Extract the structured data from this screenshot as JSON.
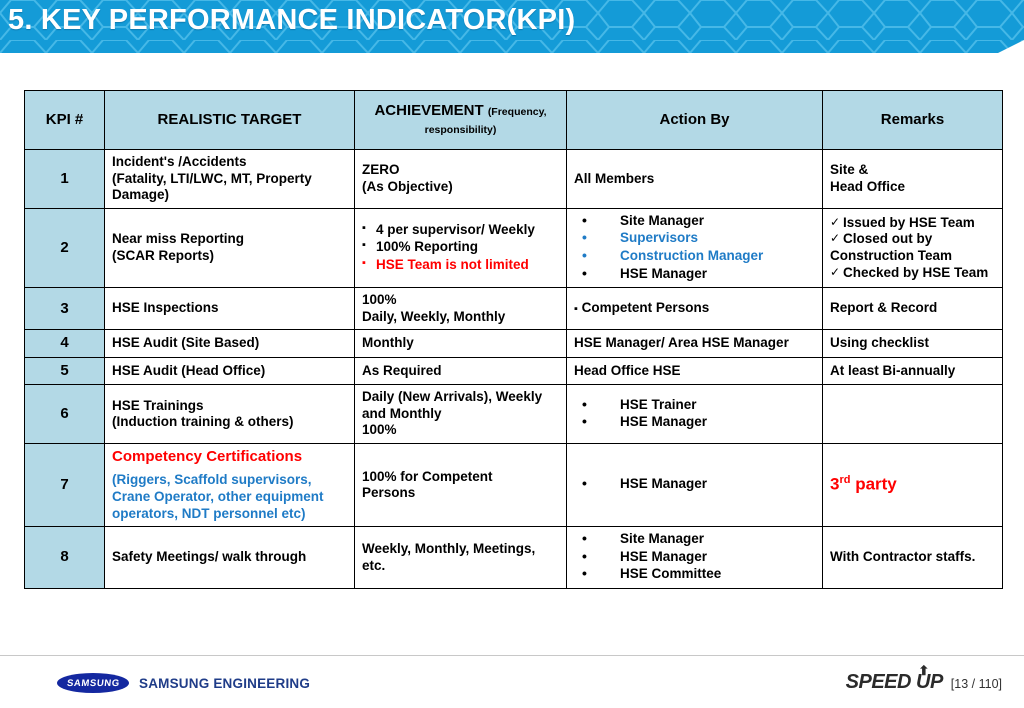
{
  "slide": {
    "title": "5. KEY PERFORMANCE INDICATOR(KPI)",
    "accent_color": "#149BD7",
    "header_cell_color": "#B3D9E6",
    "red": "#FF0000",
    "blue": "#1F7BC6"
  },
  "table": {
    "headers": {
      "kpi_num": "KPI #",
      "realistic_target": "REALISTIC TARGET",
      "achievement_main": "ACHIEVEMENT",
      "achievement_sub": "(Frequency, responsibility)",
      "action_by": "Action By",
      "remarks": "Remarks"
    },
    "rows": [
      {
        "num": "1",
        "target": [
          "Incident's /Accidents",
          "(Fatality, LTI/LWC, MT, Property",
          "Damage)"
        ],
        "achievement": [
          "ZERO",
          "(As Objective)"
        ],
        "action_by": [
          "All Members"
        ],
        "remarks": [
          "Site &",
          " Head Office"
        ]
      },
      {
        "num": "2",
        "target": [
          "Near miss Reporting",
          "(SCAR Reports)"
        ],
        "achievement_items": [
          {
            "marker": "square",
            "text": "4 per supervisor/  Weekly",
            "color": "black"
          },
          {
            "marker": "square",
            "text": "100% Reporting",
            "color": "black"
          },
          {
            "marker": "square",
            "text": "HSE Team is not limited",
            "color": "red"
          }
        ],
        "action_items": [
          {
            "text": "Site Manager",
            "color": "black",
            "bullet": "black"
          },
          {
            "text": "Supervisors",
            "color": "blue",
            "bullet": "blue"
          },
          {
            "text": "Construction Manager",
            "color": "blue",
            "bullet": "blue"
          },
          {
            "text": "HSE Manager",
            "color": "black",
            "bullet": "black"
          }
        ],
        "remark_checks": [
          "Issued by HSE Team",
          "Closed out by",
          "Construction Team",
          "Checked by HSE Team"
        ],
        "remark_check_flags": [
          true,
          true,
          false,
          true
        ]
      },
      {
        "num": "3",
        "target": [
          "HSE Inspections"
        ],
        "achievement": [
          "100%",
          "Daily, Weekly, Monthly"
        ],
        "action_by_square": "Competent Persons",
        "remarks": [
          "Report & Record"
        ]
      },
      {
        "num": "4",
        "target": [
          "HSE Audit (Site Based)"
        ],
        "achievement": [
          "Monthly"
        ],
        "action_by": [
          "HSE Manager/ Area HSE Manager"
        ],
        "remarks": [
          "Using checklist"
        ]
      },
      {
        "num": "5",
        "target": [
          "HSE Audit (Head Office)"
        ],
        "achievement": [
          "As Required"
        ],
        "action_by": [
          "Head Office HSE"
        ],
        "remarks": [
          "At least Bi-annually"
        ]
      },
      {
        "num": "6",
        "target": [
          "HSE Trainings",
          "(Induction training & others)"
        ],
        "achievement_red": [
          "Daily (New Arrivals), Weekly",
          "and Monthly",
          "100%"
        ],
        "action_items": [
          {
            "text": "HSE Trainer",
            "color": "black",
            "bullet": "black"
          },
          {
            "text": "HSE Manager",
            "color": "black",
            "bullet": "black"
          }
        ],
        "remarks": [
          ""
        ]
      },
      {
        "num": "7",
        "target_red": "Competency Certifications",
        "target_blue": [
          "(Riggers, Scaffold supervisors,",
          "Crane Operator, other equipment",
          "operators, NDT personnel etc)"
        ],
        "achievement": [
          "100% for Competent",
          "Persons"
        ],
        "action_items": [
          {
            "text": "HSE Manager",
            "color": "black",
            "bullet": "black"
          }
        ],
        "remarks_big_red_pre": "3",
        "remarks_big_red_sup": "rd",
        "remarks_big_red_post": " party"
      },
      {
        "num": "8",
        "target": [
          "Safety Meetings/ walk through"
        ],
        "achievement": [
          "Weekly, Monthly, Meetings,",
          "etc."
        ],
        "action_items": [
          {
            "text": "Site Manager",
            "color": "black",
            "bullet": "black"
          },
          {
            "text": "HSE Manager",
            "color": "black",
            "bullet": "black"
          },
          {
            "text": "HSE Committee",
            "color": "black",
            "bullet": "black"
          }
        ],
        "remarks_blue": "With  Contractor staffs."
      }
    ]
  },
  "footer": {
    "logo_mark": "SAMSUNG",
    "logo_text": "SAMSUNG ENGINEERING",
    "tagline": "SPEED UP",
    "page": "[13 / 110]"
  }
}
